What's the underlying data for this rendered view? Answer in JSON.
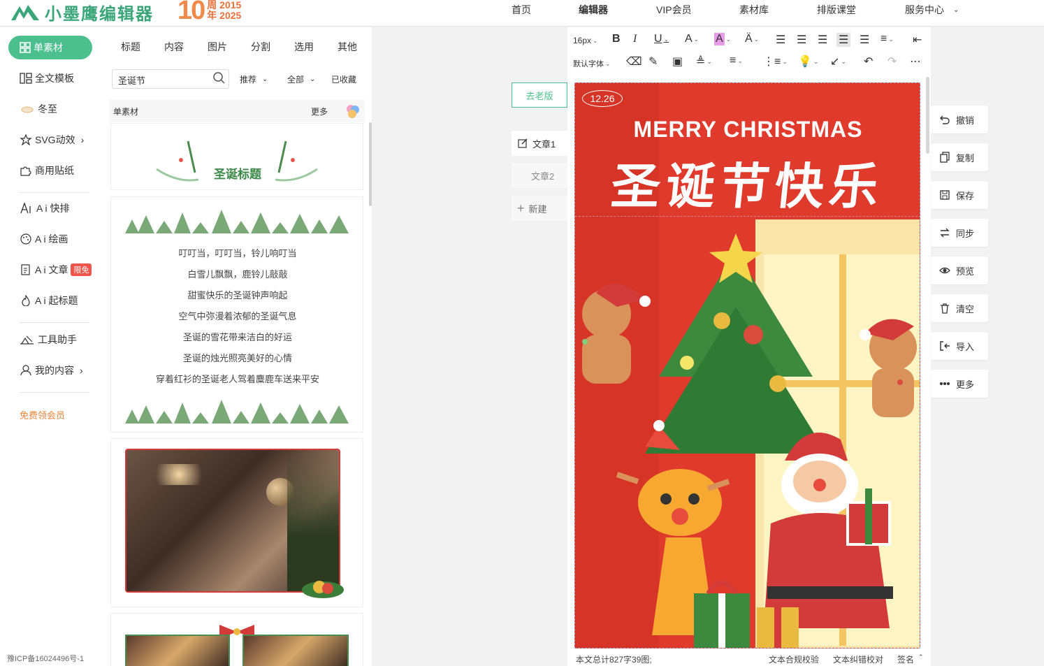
{
  "header": {
    "logo": "小墨鹰编辑器",
    "anniversary": {
      "num": "10",
      "line1": "周 2015",
      "line2": "年 2025"
    },
    "nav": [
      "首页",
      "编辑器",
      "VIP会员",
      "素材库",
      "排版课堂",
      "服务中心"
    ]
  },
  "sidebar": {
    "active": "单素材",
    "items": [
      "全文模板",
      "冬至",
      "SVG动效",
      "商用贴纸",
      "A i 快排",
      "A i 绘画",
      "A i 文章",
      "A i 起标题",
      "工具助手",
      "我的内容"
    ],
    "badge": "限免",
    "free_vip": "免费领会员",
    "icp": "豫ICP备16024496号-1"
  },
  "materials": {
    "tabs": [
      "标题",
      "内容",
      "图片",
      "分割",
      "选用",
      "其他"
    ],
    "search_value": "圣诞节",
    "filters": [
      "推荐",
      "全部",
      "已收藏"
    ],
    "category": "单素材",
    "more": "更多",
    "card1_title": "圣诞标题",
    "poem": [
      "叮叮当，叮叮当，铃儿响叮当",
      "白雪儿飘飘，鹿铃儿敲敲",
      "甜蜜快乐的圣诞钟声响起",
      "空气中弥漫着浓郁的圣诞气息",
      "圣诞的雪花带来洁白的好运",
      "圣诞的烛光照亮美好的心情",
      "穿着红衫的圣诞老人驾着麋鹿车送来平安"
    ]
  },
  "middle": {
    "old_version": "去老版",
    "articles": [
      "文章1",
      "文章2"
    ],
    "new": "新建"
  },
  "editor": {
    "font_size": "16px",
    "font_family": "默认字体",
    "poster": {
      "date": "12.26",
      "en_title": "MERRY CHRISTMAS",
      "cn_title": "圣诞节快乐"
    },
    "status": {
      "count": "本文总计827字39图;",
      "compliance": "文本合规校验",
      "proofread": "文本纠错校对",
      "signature": "签名"
    }
  },
  "actions": [
    "撤销",
    "复制",
    "保存",
    "同步",
    "预览",
    "清空",
    "导入",
    "更多"
  ],
  "colors": {
    "accent": "#4cbf8e",
    "poster_red": "#e03a2c",
    "orange": "#e9873b"
  }
}
